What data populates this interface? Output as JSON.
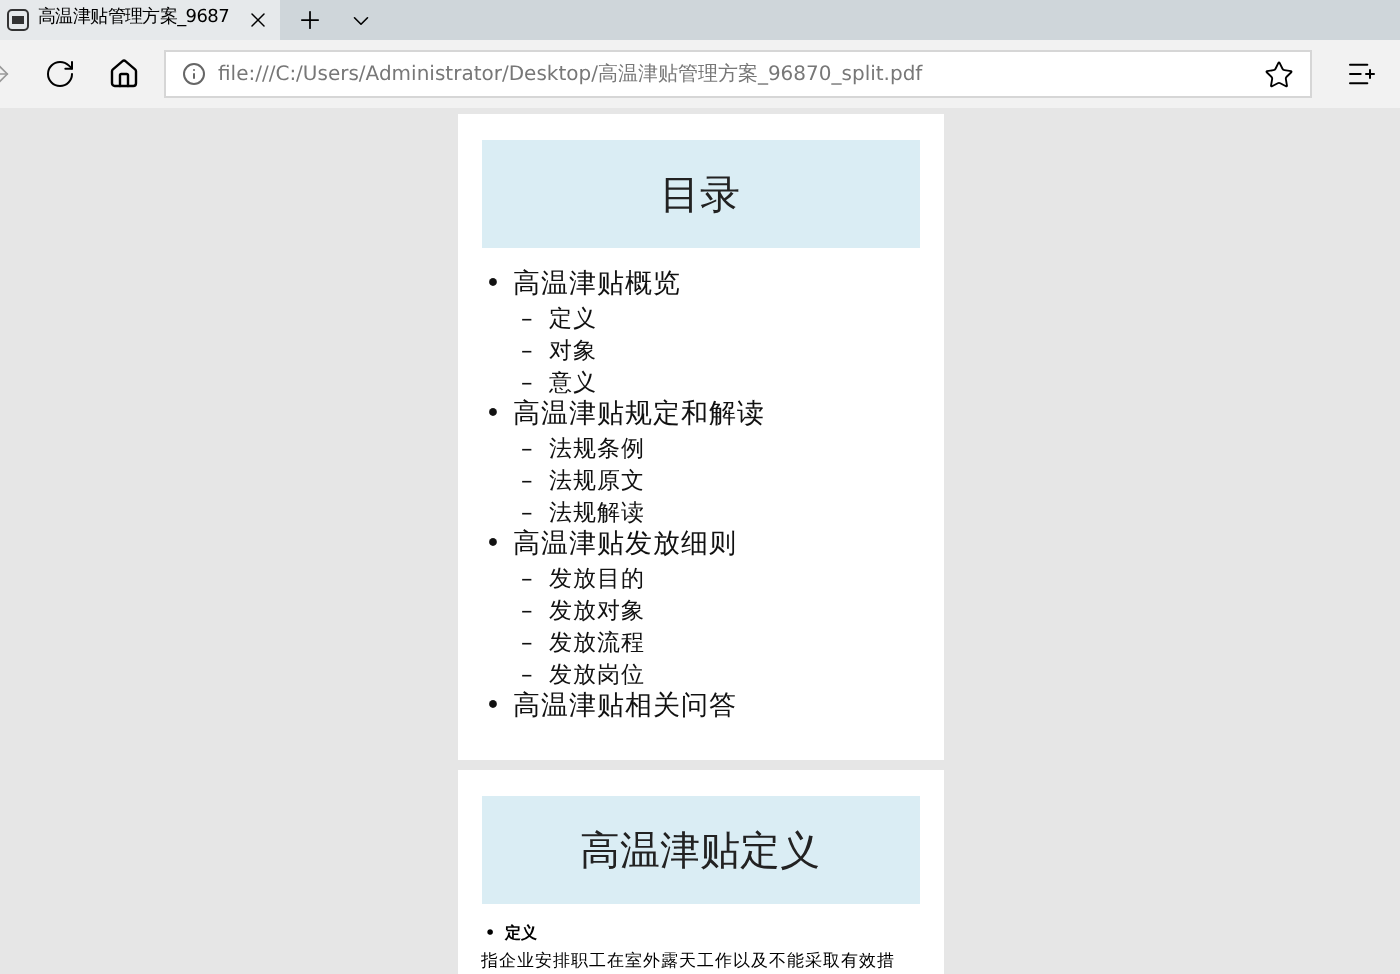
{
  "browser": {
    "tab": {
      "title": "高温津贴管理方案_9687",
      "selected": true
    },
    "address": "file:///C:/Users/Administrator/Desktop/高温津贴管理方案_96870_split.pdf"
  },
  "pages": [
    {
      "title": "目录",
      "toc": [
        {
          "marker": "•",
          "label": "高温津贴概览",
          "children": [
            {
              "marker": "–",
              "label": "定义"
            },
            {
              "marker": "–",
              "label": "对象"
            },
            {
              "marker": "–",
              "label": "意义"
            }
          ]
        },
        {
          "marker": "•",
          "label": "高温津贴规定和解读",
          "children": [
            {
              "marker": "–",
              "label": "法规条例"
            },
            {
              "marker": "–",
              "label": "法规原文"
            },
            {
              "marker": "–",
              "label": "法规解读"
            }
          ]
        },
        {
          "marker": "•",
          "label": "高温津贴发放细则",
          "children": [
            {
              "marker": "–",
              "label": "发放目的"
            },
            {
              "marker": "–",
              "label": "发放对象"
            },
            {
              "marker": "–",
              "label": "发放流程"
            },
            {
              "marker": "–",
              "label": "发放岗位"
            }
          ]
        },
        {
          "marker": "•",
          "label": "高温津贴相关问答"
        }
      ]
    },
    {
      "title": "高温津贴定义",
      "bullets": [
        {
          "marker": "•",
          "label": "定义",
          "text": "指企业安排职工在室外露天工作以及不能采取有效措"
        }
      ]
    }
  ]
}
